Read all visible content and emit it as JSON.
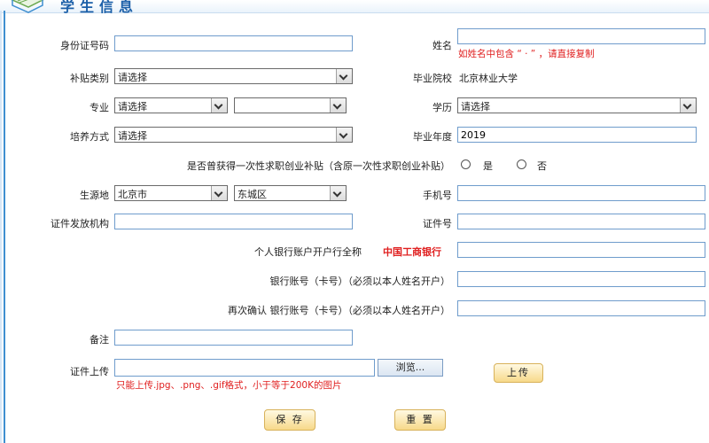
{
  "header": {
    "title": "学生信息"
  },
  "form": {
    "id_number": {
      "label": "身份证号码",
      "value": ""
    },
    "name": {
      "label": "姓名",
      "value": "",
      "hint": "如姓名中包含 “ · ” ，请直接复制"
    },
    "subsidy_type": {
      "label": "补贴类别",
      "value": "请选择"
    },
    "school": {
      "label": "毕业院校",
      "value": "北京林业大学"
    },
    "major": {
      "label": "专业",
      "value": "请选择",
      "value2": ""
    },
    "education": {
      "label": "学历",
      "value": "请选择"
    },
    "training_mode": {
      "label": "培养方式",
      "value": "请选择"
    },
    "grad_year": {
      "label": "毕业年度",
      "value": "2019"
    },
    "prior_subsidy": {
      "label": "是否曾获得一次性求职创业补贴（含原一次性求职创业补贴）",
      "yes": "是",
      "no": "否"
    },
    "origin": {
      "label": "生源地",
      "province": "北京市",
      "district": "东城区"
    },
    "phone": {
      "label": "手机号",
      "value": ""
    },
    "issuer": {
      "label": "证件发放机构",
      "value": ""
    },
    "doc_number": {
      "label": "证件号",
      "value": ""
    },
    "bank_name": {
      "label": "个人银行账户开户行全称",
      "value": "中国工商银行"
    },
    "bank_account": {
      "label": "银行账号（卡号）（必须以本人姓名开户）",
      "value": ""
    },
    "bank_account_confirm": {
      "label": "再次确认 银行账号（卡号）（必须以本人姓名开户）",
      "value": ""
    },
    "remark": {
      "label": "备注",
      "value": ""
    },
    "upload": {
      "label": "证件上传",
      "browse": "浏览...",
      "upload_button": "上传",
      "hint": "只能上传.jpg、.png、.gif格式，小于等于200K的图片"
    }
  },
  "actions": {
    "save": "保 存",
    "reset": "重 置"
  },
  "colors": {
    "title": "#1b5fa8",
    "hint": "#e02020",
    "border": "#6f9ccc"
  }
}
